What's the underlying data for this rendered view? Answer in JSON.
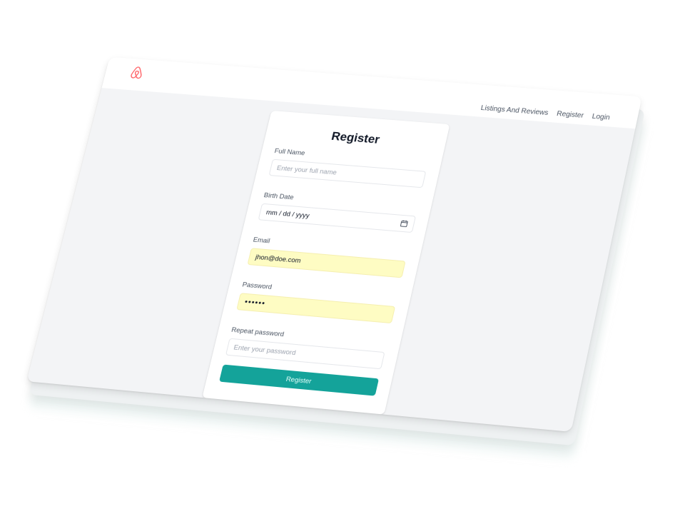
{
  "brand": {
    "logo_icon": "airbnb-logo-icon",
    "accent_color": "#ff5a5f"
  },
  "nav": {
    "items": [
      {
        "label": "Listings And Reviews"
      },
      {
        "label": "Register"
      },
      {
        "label": "Login"
      }
    ]
  },
  "form": {
    "title": "Register",
    "full_name": {
      "label": "Full Name",
      "placeholder": "Enter your full name",
      "value": ""
    },
    "birth_date": {
      "label": "Birth Date",
      "placeholder": "mm / dd / yyyy",
      "icon": "calendar-icon"
    },
    "email": {
      "label": "Email",
      "value": "jhon@doe.com"
    },
    "password": {
      "label": "Password",
      "value": "••••••"
    },
    "repeat_password": {
      "label": "Repeat password",
      "placeholder": "Enter your password",
      "value": ""
    },
    "submit_label": "Register",
    "submit_color": "#14a39a",
    "autofill_color": "#fefcc3"
  }
}
